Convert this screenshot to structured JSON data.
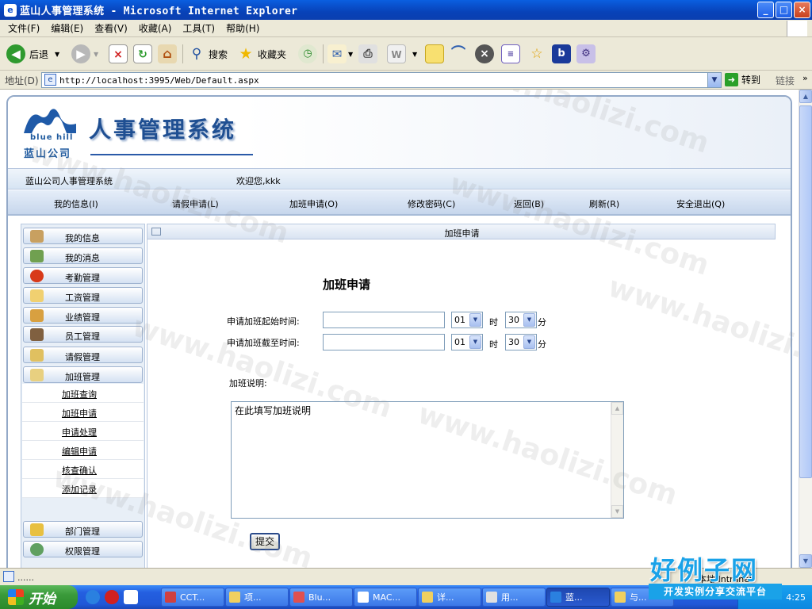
{
  "window": {
    "title": "蓝山人事管理系统 - Microsoft Internet Explorer",
    "buttons": {
      "minimize": "_",
      "maximize": "□",
      "close": "×"
    }
  },
  "menu": [
    "文件(F)",
    "编辑(E)",
    "查看(V)",
    "收藏(A)",
    "工具(T)",
    "帮助(H)"
  ],
  "toolbar": {
    "back": "后退",
    "search": "搜索",
    "favorites": "收藏夹"
  },
  "address": {
    "label": "地址(D)",
    "url": "http://localhost:3995/Web/Default.aspx",
    "go": "转到",
    "links": "链接"
  },
  "app": {
    "logo_en": "blue hill",
    "logo_cn": "蓝山公司",
    "title": "人事管理系统",
    "system_name": "蓝山公司人事管理系统",
    "welcome": "欢迎您,kkk",
    "nav": [
      "我的信息(I)",
      "请假申请(L)",
      "加班申请(O)",
      "修改密码(C)",
      "返回(B)",
      "刷新(R)",
      "安全退出(Q)"
    ],
    "sidebar_top": [
      "我的信息",
      "我的消息",
      "考勤管理",
      "工资管理",
      "业绩管理",
      "员工管理",
      "请假管理",
      "加班管理"
    ],
    "sidebar_sub": [
      "加班查询",
      "加班申请",
      "申请处理",
      "编辑申请",
      "核查确认",
      "添加记录"
    ],
    "sidebar_bottom": [
      "部门管理",
      "权限管理"
    ],
    "panel_title": "加班申请",
    "form": {
      "title": "加班申请",
      "start_label": "申请加班起始时间:",
      "end_label": "申请加班截至时间:",
      "hour_value": "01",
      "hour_unit": "时",
      "minute_value": "30",
      "minute_unit": "分",
      "remark_label": "加班说明:",
      "remark_text": "在此填写加班说明",
      "submit": "提交"
    }
  },
  "status": {
    "text": "......",
    "zone": "本地 Intranet"
  },
  "taskbar": {
    "start": "开始",
    "tasks": [
      "CCT...",
      "项...",
      "Blu...",
      "MAC...",
      "详...",
      "用...",
      "蓝...",
      "与..."
    ],
    "clock": "4:25"
  },
  "watermark": {
    "site": "www.haolizi.com",
    "brand": "好例子网",
    "slogan": "开发实例分享交流平台"
  }
}
